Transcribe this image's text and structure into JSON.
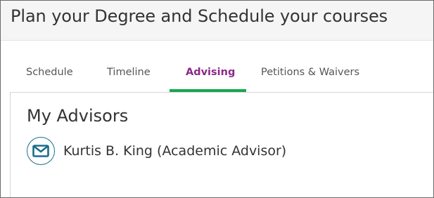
{
  "header": {
    "title": "Plan your Degree and Schedule your courses"
  },
  "tabs": [
    {
      "label": "Schedule",
      "active": false
    },
    {
      "label": "Timeline",
      "active": false
    },
    {
      "label": "Advising",
      "active": true
    },
    {
      "label": "Petitions & Waivers",
      "active": false
    }
  ],
  "advising": {
    "section_title": "My Advisors",
    "advisors": [
      {
        "name": "Kurtis B. King (Academic Advisor)",
        "icon": "envelope-icon"
      }
    ]
  },
  "colors": {
    "active_tab_text": "#8a2a87",
    "active_tab_underline": "#17a84a",
    "mail_icon": "#1a6e8a"
  }
}
